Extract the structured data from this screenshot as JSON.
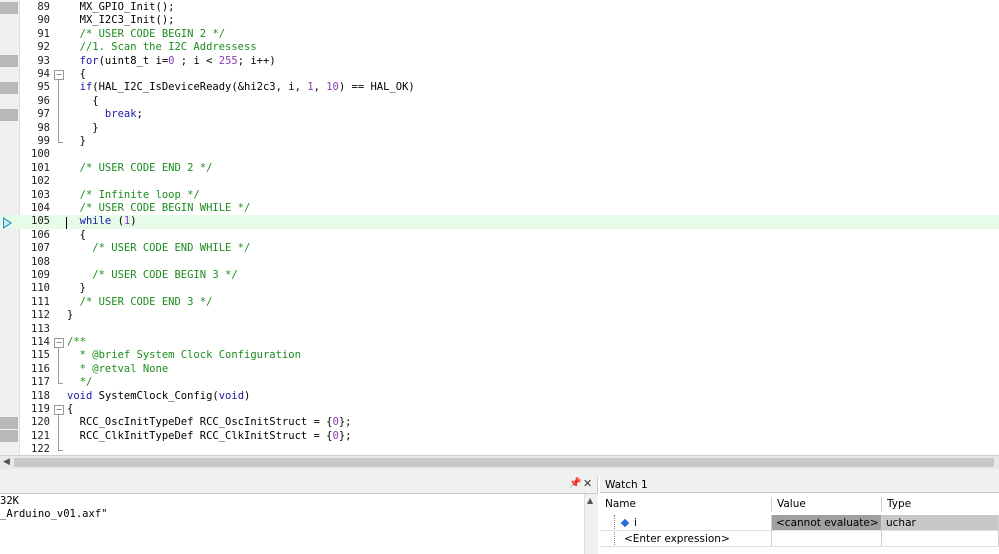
{
  "editor": {
    "lines": [
      {
        "n": "89",
        "segs": [
          [
            "",
            "  MX_GPIO_Init();"
          ]
        ]
      },
      {
        "n": "90",
        "segs": [
          [
            "",
            "  MX_I2C3_Init();"
          ]
        ]
      },
      {
        "n": "91",
        "segs": [
          [
            "cmt",
            "  /* USER CODE BEGIN 2 */"
          ]
        ]
      },
      {
        "n": "92",
        "segs": [
          [
            "cmt",
            "  //1. Scan the I2C Addressess"
          ]
        ]
      },
      {
        "n": "93",
        "segs": [
          [
            "kw",
            "  for"
          ],
          [
            "",
            "(uint8_t i="
          ],
          [
            "num",
            "0"
          ],
          [
            "",
            " ; i < "
          ],
          [
            "num",
            "255"
          ],
          [
            "",
            "; i++)"
          ]
        ]
      },
      {
        "n": "94",
        "segs": [
          [
            "",
            "  {"
          ]
        ]
      },
      {
        "n": "95",
        "segs": [
          [
            "kw",
            "  if"
          ],
          [
            "",
            "(HAL_I2C_IsDeviceReady(&hi2c3, i, "
          ],
          [
            "num",
            "1"
          ],
          [
            "",
            ", "
          ],
          [
            "num",
            "10"
          ],
          [
            "",
            ") == HAL_OK)"
          ]
        ]
      },
      {
        "n": "96",
        "segs": [
          [
            "",
            "    {"
          ]
        ]
      },
      {
        "n": "97",
        "segs": [
          [
            "kw",
            "      break"
          ],
          [
            "",
            ";"
          ]
        ]
      },
      {
        "n": "98",
        "segs": [
          [
            "",
            "    }"
          ]
        ]
      },
      {
        "n": "99",
        "segs": [
          [
            "",
            "  }"
          ]
        ]
      },
      {
        "n": "100",
        "segs": [
          [
            "",
            ""
          ]
        ]
      },
      {
        "n": "101",
        "segs": [
          [
            "cmt",
            "  /* USER CODE END 2 */"
          ]
        ]
      },
      {
        "n": "102",
        "segs": [
          [
            "",
            ""
          ]
        ]
      },
      {
        "n": "103",
        "segs": [
          [
            "cmt",
            "  /* Infinite loop */"
          ]
        ]
      },
      {
        "n": "104",
        "segs": [
          [
            "cmt",
            "  /* USER CODE BEGIN WHILE */"
          ]
        ]
      },
      {
        "n": "105",
        "segs": [
          [
            "kw",
            "  while"
          ],
          [
            "",
            " ("
          ],
          [
            "num",
            "1"
          ],
          [
            "",
            ")"
          ]
        ]
      },
      {
        "n": "106",
        "segs": [
          [
            "",
            "  {"
          ]
        ]
      },
      {
        "n": "107",
        "segs": [
          [
            "cmt",
            "    /* USER CODE END WHILE */"
          ]
        ]
      },
      {
        "n": "108",
        "segs": [
          [
            "",
            ""
          ]
        ]
      },
      {
        "n": "109",
        "segs": [
          [
            "cmt",
            "    /* USER CODE BEGIN 3 */"
          ]
        ]
      },
      {
        "n": "110",
        "segs": [
          [
            "",
            "  }"
          ]
        ]
      },
      {
        "n": "111",
        "segs": [
          [
            "cmt",
            "  /* USER CODE END 3 */"
          ]
        ]
      },
      {
        "n": "112",
        "segs": [
          [
            "",
            "}"
          ]
        ]
      },
      {
        "n": "113",
        "segs": [
          [
            "",
            ""
          ]
        ]
      },
      {
        "n": "114",
        "segs": [
          [
            "cmt",
            "/**"
          ]
        ]
      },
      {
        "n": "115",
        "segs": [
          [
            "cmt",
            "  * @brief System Clock Configuration"
          ]
        ]
      },
      {
        "n": "116",
        "segs": [
          [
            "cmt",
            "  * @retval None"
          ]
        ]
      },
      {
        "n": "117",
        "segs": [
          [
            "cmt",
            "  */"
          ]
        ]
      },
      {
        "n": "118",
        "segs": [
          [
            "kw",
            "void"
          ],
          [
            "",
            " SystemClock_Config("
          ],
          [
            "kw",
            "void"
          ],
          [
            "",
            ")"
          ]
        ]
      },
      {
        "n": "119",
        "segs": [
          [
            "",
            "{"
          ]
        ]
      },
      {
        "n": "120",
        "segs": [
          [
            "",
            "  RCC_OscInitTypeDef RCC_OscInitStruct = {"
          ],
          [
            "num",
            "0"
          ],
          [
            "",
            "};"
          ]
        ]
      },
      {
        "n": "121",
        "segs": [
          [
            "",
            "  RCC_ClkInitTypeDef RCC_ClkInitStruct = {"
          ],
          [
            "num",
            "0"
          ],
          [
            "",
            "};"
          ]
        ]
      },
      {
        "n": "122",
        "segs": [
          [
            "",
            ""
          ]
        ]
      }
    ]
  },
  "build_output": {
    "lines": [
      "32K",
      "_Arduino_v01.axf\""
    ],
    "pin_icon": "pin-icon",
    "close_icon": "close-icon"
  },
  "watch": {
    "tab_label": "Watch 1",
    "columns": {
      "name": "Name",
      "value": "Value",
      "type": "Type"
    },
    "rows": [
      {
        "name": "i",
        "value": "<cannot evaluate>",
        "type": "uchar"
      },
      {
        "name": "<Enter expression>",
        "value": "",
        "type": ""
      }
    ]
  },
  "icons": {
    "current_line": "execution-arrow-icon",
    "scroll_left": "scroll-left-icon"
  }
}
